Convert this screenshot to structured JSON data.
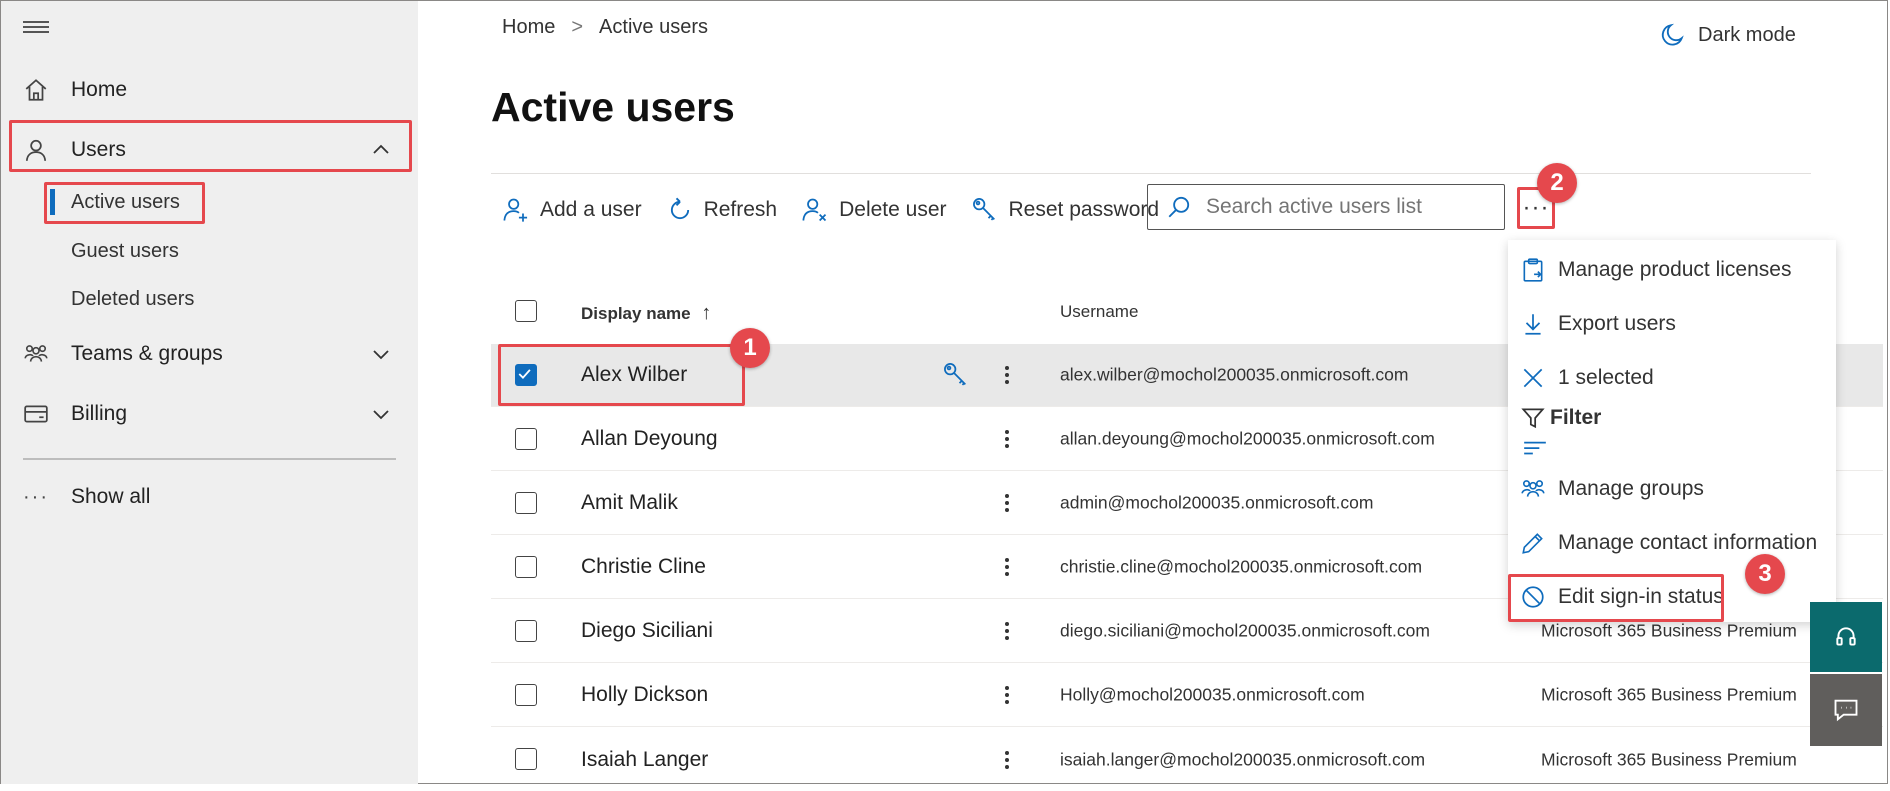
{
  "breadcrumb": {
    "home": "Home",
    "separator": ">",
    "current": "Active users"
  },
  "header": {
    "dark_mode": "Dark mode"
  },
  "sidebar": {
    "home": "Home",
    "users": "Users",
    "users_sub": [
      "Active users",
      "Guest users",
      "Deleted users"
    ],
    "teams": "Teams & groups",
    "billing": "Billing",
    "show_all_dots": "···",
    "show_all": "Show all"
  },
  "page": {
    "title": "Active users"
  },
  "toolbar": {
    "add_user": "Add a user",
    "refresh": "Refresh",
    "delete_user": "Delete user",
    "reset_password": "Reset password",
    "more": "···"
  },
  "search": {
    "placeholder": "Search active users list"
  },
  "table": {
    "columns": {
      "display_name": "Display name",
      "sort_arrow": "↑",
      "username": "Username"
    },
    "rows": [
      {
        "name": "Alex Wilber",
        "username": "alex.wilber@mochol200035.onmicrosoft.com",
        "license": ""
      },
      {
        "name": "Allan Deyoung",
        "username": "allan.deyoung@mochol200035.onmicrosoft.com",
        "license": ""
      },
      {
        "name": "Amit Malik",
        "username": "admin@mochol200035.onmicrosoft.com",
        "license": ""
      },
      {
        "name": "Christie Cline",
        "username": "christie.cline@mochol200035.onmicrosoft.com",
        "license": ""
      },
      {
        "name": "Diego Siciliani",
        "username": "diego.siciliani@mochol200035.onmicrosoft.com",
        "license": "Microsoft 365 Business Premium"
      },
      {
        "name": "Holly Dickson",
        "username": "Holly@mochol200035.onmicrosoft.com",
        "license": "Microsoft 365 Business Premium"
      },
      {
        "name": "Isaiah Langer",
        "username": "isaiah.langer@mochol200035.onmicrosoft.com",
        "license": "Microsoft 365 Business Premium"
      }
    ]
  },
  "menu": {
    "items": [
      "Manage product licenses",
      "Export users",
      "1 selected",
      "Filter",
      "Manage groups",
      "Manage contact information",
      "Edit sign-in status"
    ]
  },
  "badges": [
    "1",
    "2",
    "3"
  ],
  "colors": {
    "accent": "#0f6cbd",
    "highlight": "#e5484d",
    "sidebar_bg": "#efefef",
    "teal": "#0b6a6d"
  }
}
